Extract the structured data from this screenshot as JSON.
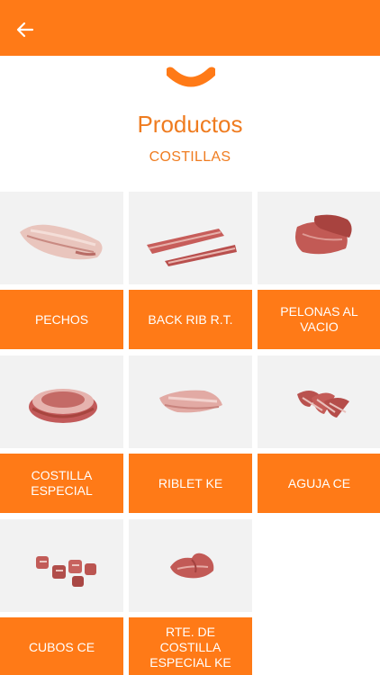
{
  "header": {
    "back_icon": "arrow-left-icon",
    "bar_color": "#ff7a17",
    "logo_icon": "sausage-logo-icon"
  },
  "page": {
    "title": "Productos",
    "subtitle": "COSTILLAS"
  },
  "products": [
    {
      "label": "PECHOS",
      "image": "pork-breast-icon"
    },
    {
      "label": "BACK RIB R.T.",
      "image": "back-rib-icon"
    },
    {
      "label": "PELONAS AL VACIO",
      "image": "pelonas-icon"
    },
    {
      "label": "COSTILLA ESPECIAL",
      "image": "costilla-especial-icon"
    },
    {
      "label": "RIBLET KE",
      "image": "riblet-icon"
    },
    {
      "label": "AGUJA CE",
      "image": "aguja-icon"
    },
    {
      "label": "CUBOS CE",
      "image": "cubos-icon"
    },
    {
      "label": "RTE. DE COSTILLA ESPECIAL KE",
      "image": "rte-costilla-icon"
    }
  ]
}
